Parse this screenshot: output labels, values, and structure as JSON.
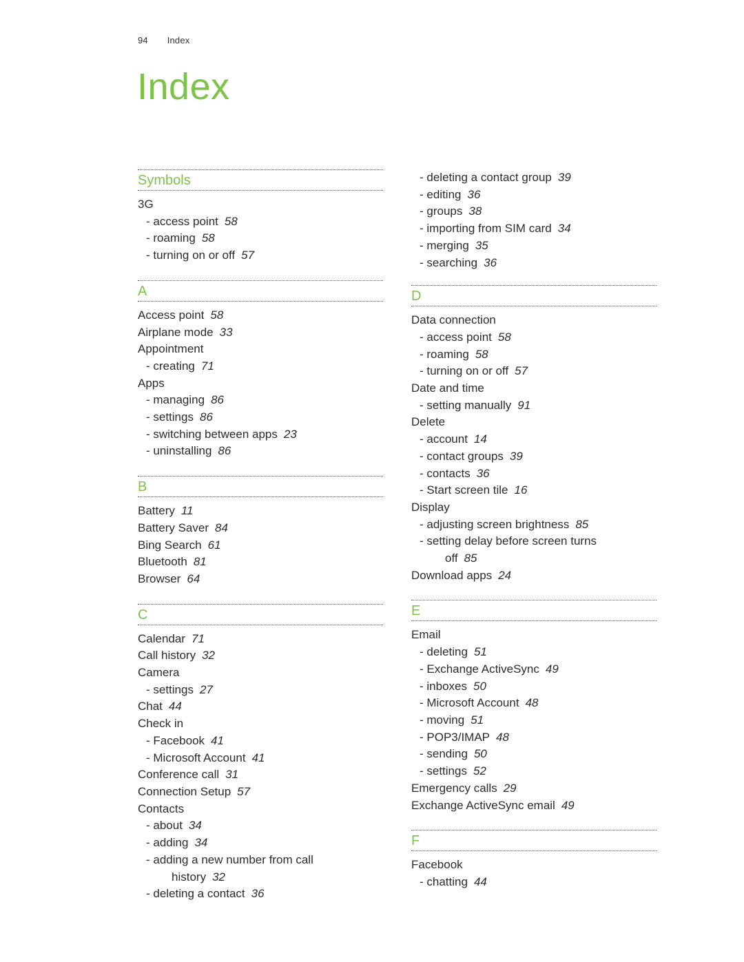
{
  "header": {
    "page_number": "94",
    "section": "Index"
  },
  "title": "Index",
  "accent_color": "#7dc24b",
  "left_column": [
    {
      "letter": "Symbols",
      "entries": [
        {
          "text": "3G",
          "page": "",
          "level": "main"
        },
        {
          "text": "- access point",
          "page": "58",
          "level": "sub"
        },
        {
          "text": "- roaming",
          "page": "58",
          "level": "sub"
        },
        {
          "text": "- turning on or off",
          "page": "57",
          "level": "sub"
        }
      ]
    },
    {
      "letter": "A",
      "entries": [
        {
          "text": "Access point",
          "page": "58",
          "level": "main"
        },
        {
          "text": "Airplane mode",
          "page": "33",
          "level": "main"
        },
        {
          "text": "Appointment",
          "page": "",
          "level": "main"
        },
        {
          "text": "- creating",
          "page": "71",
          "level": "sub"
        },
        {
          "text": "Apps",
          "page": "",
          "level": "main"
        },
        {
          "text": "- managing",
          "page": "86",
          "level": "sub"
        },
        {
          "text": "- settings",
          "page": "86",
          "level": "sub"
        },
        {
          "text": "- switching between apps",
          "page": "23",
          "level": "sub"
        },
        {
          "text": "- uninstalling",
          "page": "86",
          "level": "sub"
        }
      ]
    },
    {
      "letter": "B",
      "entries": [
        {
          "text": "Battery",
          "page": "11",
          "level": "main"
        },
        {
          "text": "Battery Saver",
          "page": "84",
          "level": "main"
        },
        {
          "text": "Bing Search",
          "page": "61",
          "level": "main"
        },
        {
          "text": "Bluetooth",
          "page": "81",
          "level": "main"
        },
        {
          "text": "Browser",
          "page": "64",
          "level": "main"
        }
      ]
    },
    {
      "letter": "C",
      "entries": [
        {
          "text": "Calendar",
          "page": "71",
          "level": "main"
        },
        {
          "text": "Call history",
          "page": "32",
          "level": "main"
        },
        {
          "text": "Camera",
          "page": "",
          "level": "main"
        },
        {
          "text": "- settings",
          "page": "27",
          "level": "sub"
        },
        {
          "text": "Chat",
          "page": "44",
          "level": "main"
        },
        {
          "text": "Check in",
          "page": "",
          "level": "main"
        },
        {
          "text": "- Facebook",
          "page": "41",
          "level": "sub"
        },
        {
          "text": "- Microsoft Account",
          "page": "41",
          "level": "sub"
        },
        {
          "text": "Conference call",
          "page": "31",
          "level": "main"
        },
        {
          "text": "Connection Setup",
          "page": "57",
          "level": "main"
        },
        {
          "text": "Contacts",
          "page": "",
          "level": "main"
        },
        {
          "text": "- about",
          "page": "34",
          "level": "sub"
        },
        {
          "text": "- adding",
          "page": "34",
          "level": "sub"
        },
        {
          "text": "- adding a new number from call",
          "page": "",
          "level": "sub"
        },
        {
          "text": "history",
          "page": "32",
          "level": "cont"
        },
        {
          "text": "- deleting a contact",
          "page": "36",
          "level": "sub"
        }
      ]
    }
  ],
  "right_column": {
    "continued_entries": [
      {
        "text": "- deleting a contact group",
        "page": "39",
        "level": "sub"
      },
      {
        "text": "- editing",
        "page": "36",
        "level": "sub"
      },
      {
        "text": "- groups",
        "page": "38",
        "level": "sub"
      },
      {
        "text": "- importing from SIM card",
        "page": "34",
        "level": "sub"
      },
      {
        "text": "- merging",
        "page": "35",
        "level": "sub"
      },
      {
        "text": "- searching",
        "page": "36",
        "level": "sub"
      }
    ],
    "sections": [
      {
        "letter": "D",
        "entries": [
          {
            "text": "Data connection",
            "page": "",
            "level": "main"
          },
          {
            "text": "- access point",
            "page": "58",
            "level": "sub"
          },
          {
            "text": "- roaming",
            "page": "58",
            "level": "sub"
          },
          {
            "text": "- turning on or off",
            "page": "57",
            "level": "sub"
          },
          {
            "text": "Date and time",
            "page": "",
            "level": "main"
          },
          {
            "text": "- setting manually",
            "page": "91",
            "level": "sub"
          },
          {
            "text": "Delete",
            "page": "",
            "level": "main"
          },
          {
            "text": "- account",
            "page": "14",
            "level": "sub"
          },
          {
            "text": "- contact groups",
            "page": "39",
            "level": "sub"
          },
          {
            "text": "- contacts",
            "page": "36",
            "level": "sub"
          },
          {
            "text": "- Start screen tile",
            "page": "16",
            "level": "sub"
          },
          {
            "text": "Display",
            "page": "",
            "level": "main"
          },
          {
            "text": "- adjusting screen brightness",
            "page": "85",
            "level": "sub"
          },
          {
            "text": "- setting delay before screen turns",
            "page": "",
            "level": "sub"
          },
          {
            "text": "off",
            "page": "85",
            "level": "cont"
          },
          {
            "text": "Download apps",
            "page": "24",
            "level": "main"
          }
        ]
      },
      {
        "letter": "E",
        "entries": [
          {
            "text": "Email",
            "page": "",
            "level": "main"
          },
          {
            "text": "- deleting",
            "page": "51",
            "level": "sub"
          },
          {
            "text": "- Exchange ActiveSync",
            "page": "49",
            "level": "sub"
          },
          {
            "text": "- inboxes",
            "page": "50",
            "level": "sub"
          },
          {
            "text": "- Microsoft Account",
            "page": "48",
            "level": "sub"
          },
          {
            "text": "- moving",
            "page": "51",
            "level": "sub"
          },
          {
            "text": "- POP3/IMAP",
            "page": "48",
            "level": "sub"
          },
          {
            "text": "- sending",
            "page": "50",
            "level": "sub"
          },
          {
            "text": "- settings",
            "page": "52",
            "level": "sub"
          },
          {
            "text": "Emergency calls",
            "page": "29",
            "level": "main"
          },
          {
            "text": "Exchange ActiveSync email",
            "page": "49",
            "level": "main"
          }
        ]
      },
      {
        "letter": "F",
        "entries": [
          {
            "text": "Facebook",
            "page": "",
            "level": "main"
          },
          {
            "text": "- chatting",
            "page": "44",
            "level": "sub"
          }
        ]
      }
    ]
  }
}
